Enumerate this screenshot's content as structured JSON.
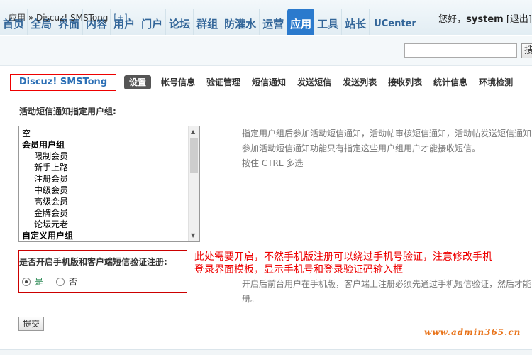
{
  "topnav": {
    "tabs": [
      {
        "label": "首页"
      },
      {
        "label": "全局"
      },
      {
        "label": "界面"
      },
      {
        "label": "内容"
      },
      {
        "label": "用户"
      },
      {
        "label": "门户"
      },
      {
        "label": "论坛"
      },
      {
        "label": "群组"
      },
      {
        "label": "防灌水"
      },
      {
        "label": "运营"
      },
      {
        "label": "应用",
        "active": true
      },
      {
        "label": "工具"
      },
      {
        "label": "站长"
      },
      {
        "label": "UCenter"
      }
    ],
    "greeting": "您好，",
    "username": "system",
    "logout": "[退出]"
  },
  "breadcrumb": {
    "section": "应用",
    "separator": "»",
    "current": "Discuz! SMSTong",
    "add": "[+]"
  },
  "search": {
    "value": "",
    "button": "搜"
  },
  "plugin": {
    "title": "Discuz! SMSTong",
    "subtabs": [
      {
        "label": "设置",
        "active": true
      },
      {
        "label": "帐号信息"
      },
      {
        "label": "验证管理"
      },
      {
        "label": "短信通知"
      },
      {
        "label": "发送短信"
      },
      {
        "label": "发送列表"
      },
      {
        "label": "接收列表"
      },
      {
        "label": "统计信息"
      },
      {
        "label": "环境检测"
      }
    ]
  },
  "setting_groups": {
    "label": "活动短信通知指定用户组:",
    "options": [
      {
        "text": "空",
        "kind": "plain"
      },
      {
        "text": "会员用户组",
        "kind": "group"
      },
      {
        "text": "限制会员",
        "kind": "indent"
      },
      {
        "text": "新手上路",
        "kind": "indent"
      },
      {
        "text": "注册会员",
        "kind": "indent"
      },
      {
        "text": "中级会员",
        "kind": "indent"
      },
      {
        "text": "高级会员",
        "kind": "indent"
      },
      {
        "text": "金牌会员",
        "kind": "indent"
      },
      {
        "text": "论坛元老",
        "kind": "indent"
      },
      {
        "text": "自定义用户组",
        "kind": "group"
      }
    ],
    "hint_lines": [
      "指定用户组后参加活动短信通知，活动帖审核短信通知，活动帖发送短信通知",
      "参加活动短信通知功能只有指定这些用户组用户才能接收短信。",
      "按住 CTRL 多选"
    ]
  },
  "setting_mobile": {
    "label": "是否开启手机版和客户端短信验证注册:",
    "yes": "是",
    "no": "否",
    "selected": "yes",
    "annotation_lines": [
      "此处需要开启，不然手机版注册可以绕过手机号验证，注意修改手机",
      "登录界面模板，显示手机号和登录验证码输入框"
    ],
    "hint_lines": [
      "开启后前台用户在手机版，客户端上注册必须先通过手机短信验证，然后才能",
      "册。"
    ]
  },
  "submit": "提交",
  "watermark": "www.admin365.cn",
  "colors": {
    "active_tab": "#2b7acd",
    "plugin_title": "#2b6fb5",
    "annotation": "#e00000",
    "watermark": "#e8731a"
  }
}
